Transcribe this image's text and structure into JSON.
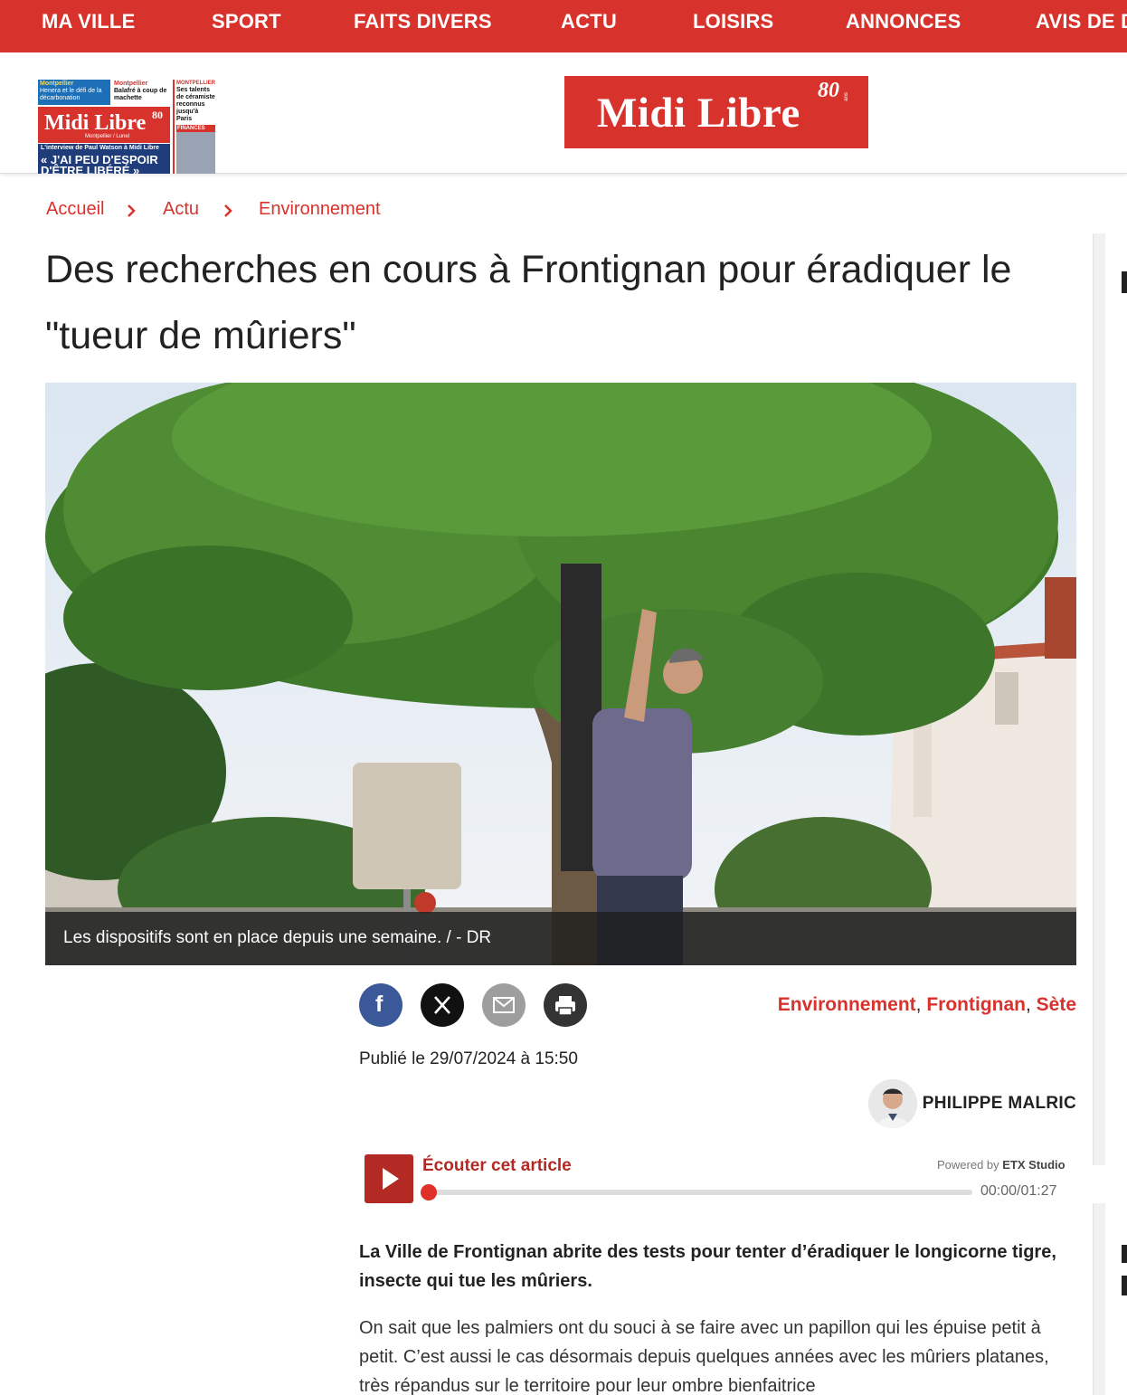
{
  "nav": {
    "items": [
      "MA VILLE",
      "SPORT",
      "FAITS DIVERS",
      "ACTU",
      "LOISIRS",
      "ANNONCES",
      "AVIS DE D"
    ]
  },
  "frontpage": {
    "col1_kicker": "Montpellier",
    "col1_text": "Henera et le défi de la décarbonation",
    "col2_kicker": "Montpellier",
    "col2_text": "Balafré à coup de machette",
    "col3_kicker": "MONTPELLIER",
    "col3_text": "Ses talents de céramiste reconnus jusqu'à Paris",
    "col3_section": "FINANCES",
    "logo": "Midi Libre",
    "logo_80": "80",
    "logo_sub": "Montpellier / Lunel",
    "band_kicker": "L'interview de Paul Watson à Midi Libre",
    "band_line1": "« J'AI PEU D'ESPOIR",
    "band_line2": "D'ÊTRE LIBÉRÉ »"
  },
  "brand": {
    "name": "Midi Libre",
    "eighty": "80",
    "ans": "ans"
  },
  "breadcrumb": [
    "Accueil",
    "Actu",
    "Environnement"
  ],
  "article": {
    "title": "Des recherches en cours à Frontignan pour éradiquer le \"tueur de mûriers\"",
    "caption": "Les dispositifs sont en place depuis une semaine.  /  - DR",
    "tags": [
      "Environnement",
      "Frontignan",
      "Sète"
    ],
    "tag_sep": ", ",
    "published": "Publié le 29/07/2024 à 15:50",
    "author": "PHILIPPE MALRIC",
    "lead": "La Ville de Frontignan abrite des tests pour tenter d’éradiquer le longicorne tigre, insecte qui tue les mûriers.",
    "paragraph": "On sait que les palmiers ont du souci à se faire avec un papillon qui les épuise petit à petit. C’est aussi le cas désormais depuis quelques années avec les mûriers platanes, très répandus sur le territoire pour leur ombre bienfaitrice"
  },
  "share": {
    "icons": [
      "facebook-icon",
      "x-icon",
      "email-icon",
      "print-icon"
    ],
    "facebook_letter": "f"
  },
  "audio": {
    "label": "Écouter cet article",
    "powered_by": "Powered by",
    "provider": "ETX Studio",
    "time": "00:00/01:27",
    "progress": 0
  },
  "colors": {
    "brand_red": "#d8322d",
    "facebook": "#3b5998",
    "x": "#111111",
    "email": "#9e9e9e",
    "print": "#333333"
  }
}
